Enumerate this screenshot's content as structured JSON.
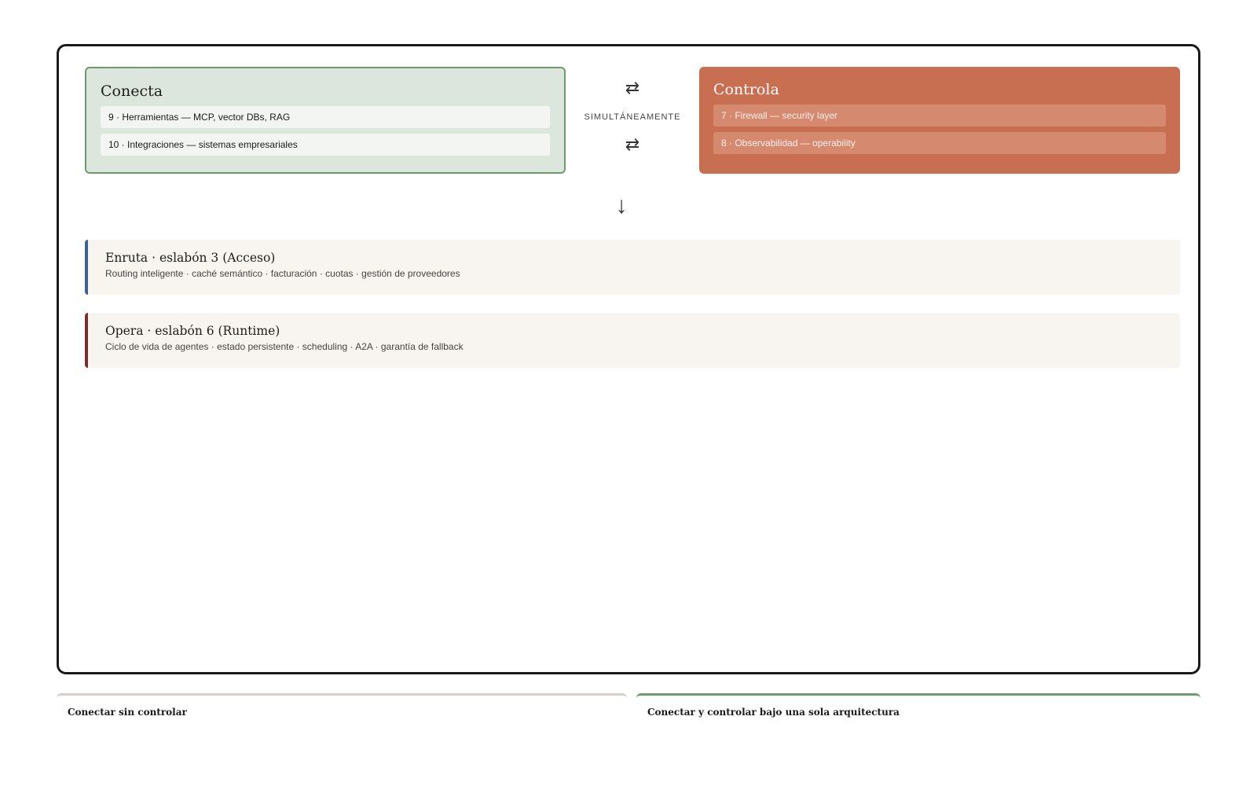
{
  "conecta": {
    "title": "Conecta",
    "items": [
      "9 · Herramientas — MCP, vector DBs, RAG",
      "10 · Integraciones — sistemas empresariales"
    ]
  },
  "controla": {
    "title": "Controla",
    "items": [
      "7 · Firewall — security layer",
      "8 · Observabilidad — operability"
    ]
  },
  "middle": {
    "swap_top": "⇄",
    "label": "SIMULTÁNEAMENTE",
    "swap_bottom": "⇄"
  },
  "down_arrow": "↓",
  "layers": [
    {
      "title": "Enruta · eslabón 3 (Acceso)",
      "desc": "Routing inteligente · caché semántico · facturación · cuotas · gestión de proveedores"
    },
    {
      "title": "Opera · eslabón 6 (Runtime)",
      "desc": "Ciclo de vida de agentes · estado persistente · scheduling · A2A · garantía de fallback"
    }
  ],
  "bottom": {
    "left_label": "Conectar sin controlar",
    "right_label": "Conectar y controlar bajo una sola arquitectura"
  },
  "colors": {
    "conecta_bg": "#dce6dc",
    "controla_bg": "#c96f51",
    "enruta_accent": "#3e6294",
    "opera_accent": "#7a2f2a"
  }
}
